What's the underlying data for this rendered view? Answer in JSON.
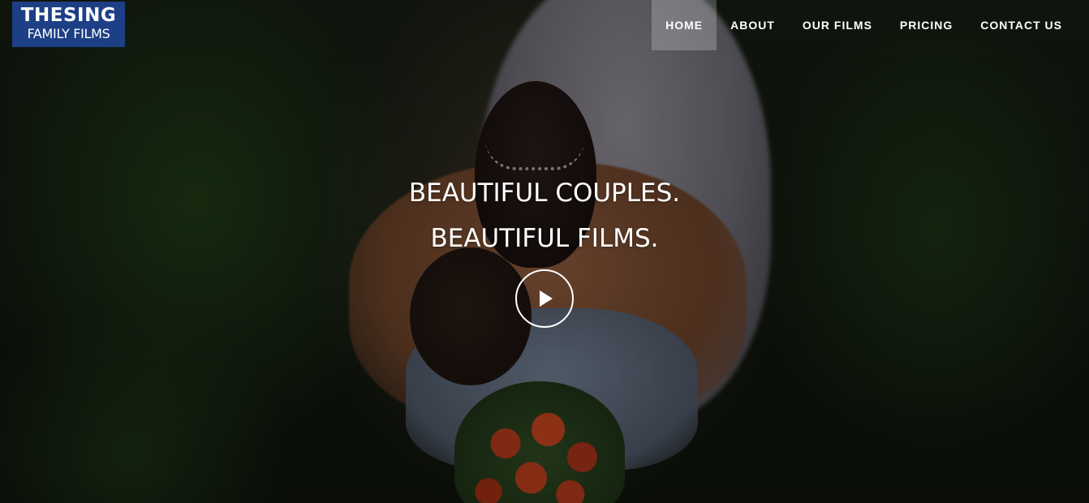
{
  "logo": {
    "line1": "THESING",
    "line2": "FAMILY FILMS"
  },
  "nav": {
    "items": [
      {
        "label": "HOME",
        "active": true
      },
      {
        "label": "ABOUT",
        "active": false
      },
      {
        "label": "OUR FILMS",
        "active": false
      },
      {
        "label": "PRICING",
        "active": false
      },
      {
        "label": "CONTACT US",
        "active": false
      }
    ]
  },
  "hero": {
    "headline_line1": "BEAUTIFUL COUPLES.",
    "headline_line2": "BEAUTIFUL FILMS.",
    "play_icon": "play-icon"
  },
  "colors": {
    "logo_background": "#1d3f86",
    "text": "#ffffff",
    "nav_active_background": "rgba(255,255,255,0.22)"
  }
}
